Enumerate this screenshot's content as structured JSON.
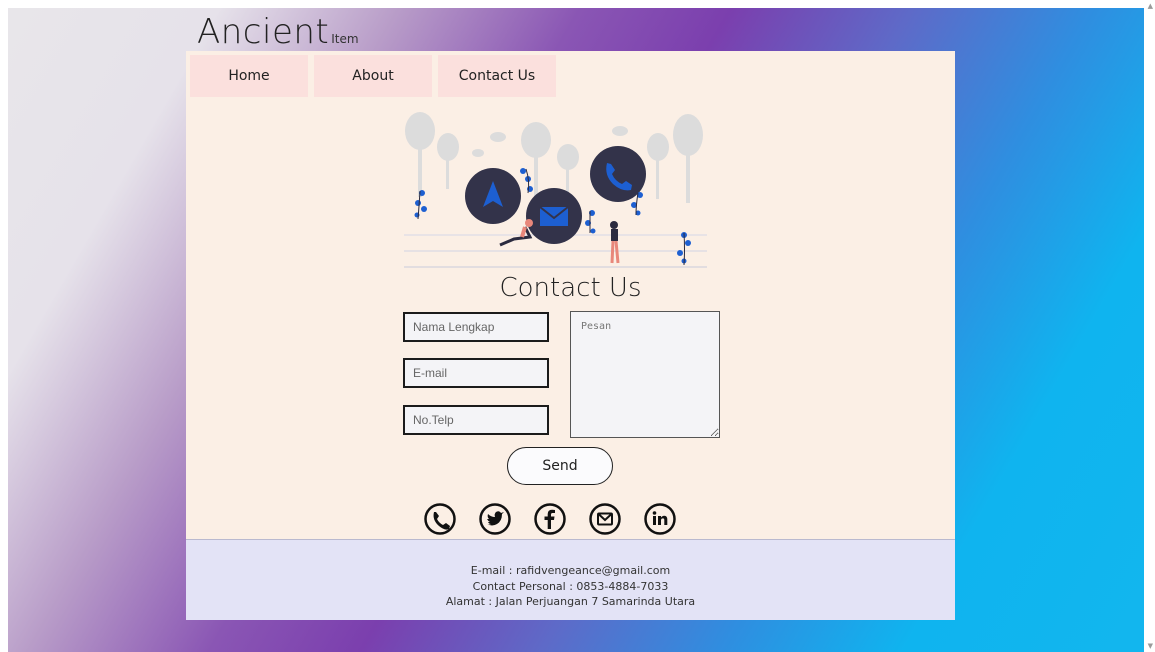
{
  "logo": {
    "main": "Ancient",
    "sub": "Item"
  },
  "nav": {
    "items": [
      {
        "label": "Home"
      },
      {
        "label": "About"
      },
      {
        "label": "Contact Us"
      }
    ]
  },
  "hero": {
    "illustration": "contact-illustration"
  },
  "page": {
    "title": "Contact Us"
  },
  "form": {
    "name_placeholder": "Nama Lengkap",
    "email_placeholder": "E-mail",
    "phone_placeholder": "No.Telp",
    "message_placeholder": "Pesan",
    "send_label": "Send"
  },
  "social": {
    "icons": [
      "phone-icon",
      "twitter-icon",
      "facebook-icon",
      "gmail-icon",
      "linkedin-icon"
    ]
  },
  "footer": {
    "email": "E-mail : rafidvengeance@gmail.com",
    "contact": "Contact Personal : 0853-4884-7033",
    "address": "Alamat : Jalan Perjuangan 7 Samarinda Utara"
  },
  "colors": {
    "card_bg": "#fbefe5",
    "nav_bg": "#fbe0dd",
    "footer_bg": "#e3e3f6",
    "accent_blue": "#1d5fd1",
    "icon_dark": "#33334a"
  }
}
